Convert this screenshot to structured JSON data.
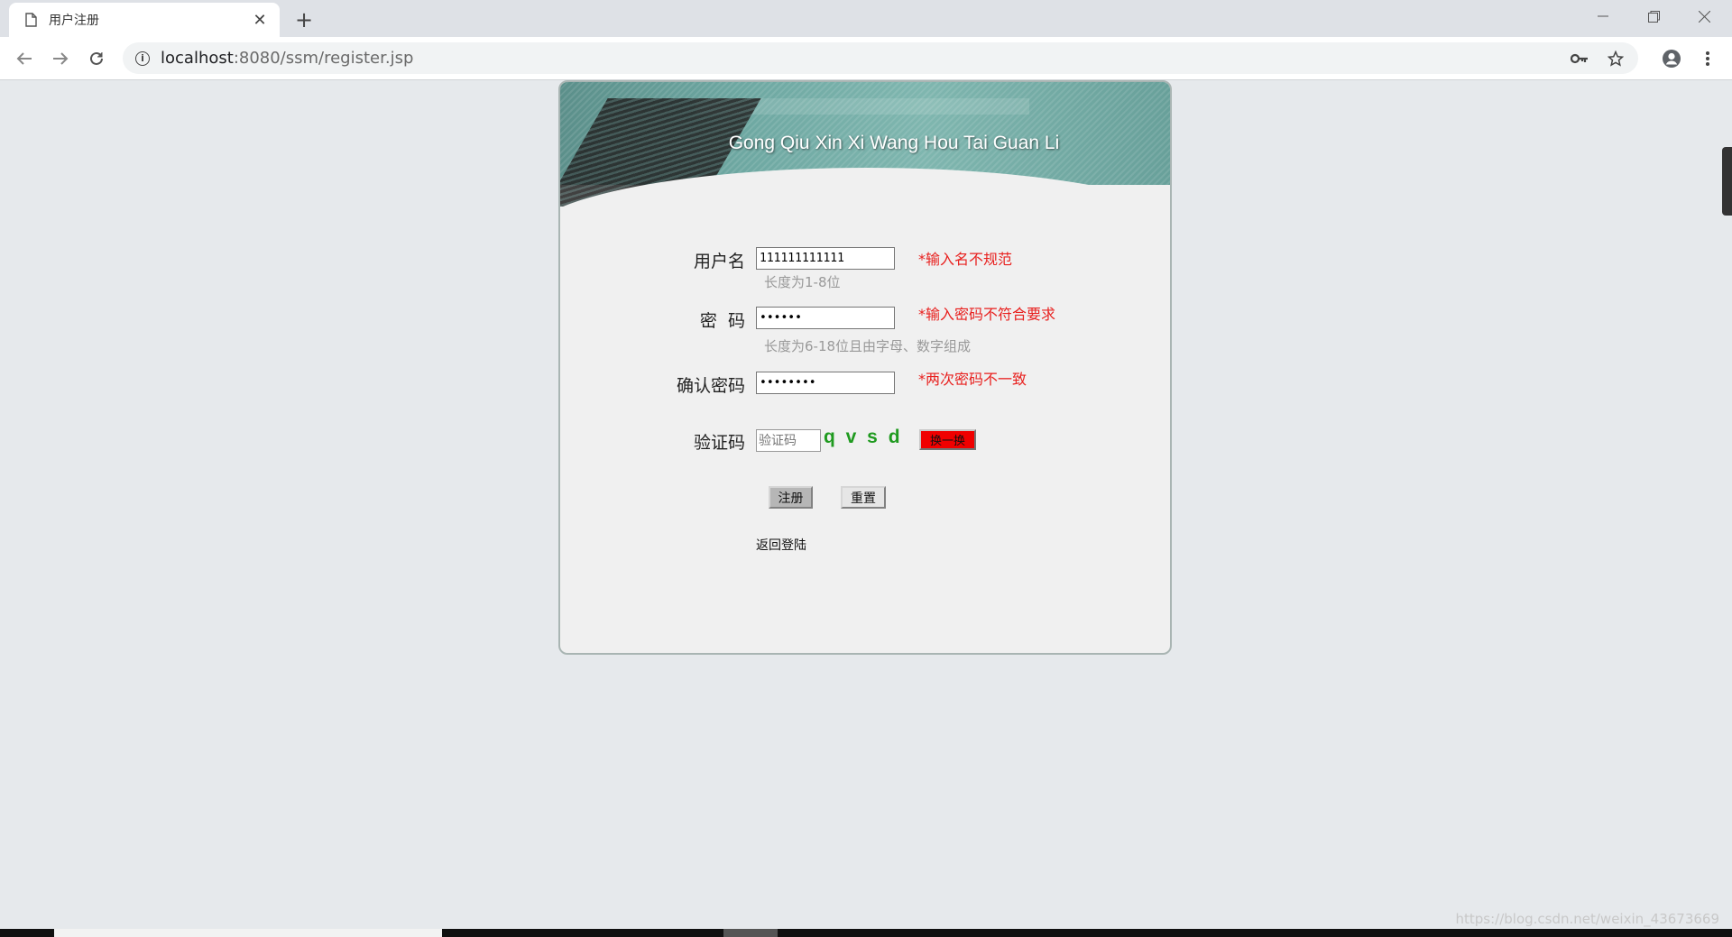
{
  "browser": {
    "tab_title": "用户注册",
    "tab_close": "✕",
    "new_tab": "+",
    "url_host": "localhost",
    "url_rest": ":8080/ssm/register.jsp",
    "info_icon": "i"
  },
  "page": {
    "banner_title": "Gong Qiu Xin Xi Wang Hou Tai Guan Li",
    "username": {
      "label": "用户名",
      "value": "111111111111",
      "error": "*输入名不规范",
      "hint": "长度为1-8位"
    },
    "password": {
      "label": "密  码",
      "value": "••••••",
      "error": "*输入密码不符合要求",
      "hint": "长度为6-18位且由字母、数字组成"
    },
    "confirm": {
      "label": "确认密码",
      "value": "••••••••",
      "error": "*两次密码不一致"
    },
    "captcha": {
      "label": "验证码",
      "placeholder": "验证码",
      "code": "q v s d",
      "refresh_label": "换一换"
    },
    "register_button": "注册",
    "reset_button": "重置",
    "back_link": "返回登陆"
  },
  "watermark": "https://blog.csdn.net/weixin_43673669",
  "colors": {
    "error": "#e8201e",
    "captcha": "#1f9a1f",
    "refresh_button": "#f00000",
    "banner": "#6ea8a2"
  }
}
